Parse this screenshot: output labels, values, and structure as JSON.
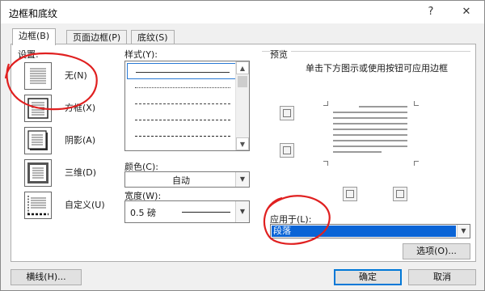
{
  "window": {
    "title": "边框和底纹",
    "help_label": "?",
    "close_label": "✕"
  },
  "tabs": [
    {
      "label": "边框(B)",
      "active": true
    },
    {
      "label": "页面边框(P)",
      "active": false
    },
    {
      "label": "底纹(S)",
      "active": false
    }
  ],
  "settings": {
    "label": "设置:",
    "items": [
      {
        "label": "无(N)",
        "icon": "border-none-icon"
      },
      {
        "label": "方框(X)",
        "icon": "border-box-icon"
      },
      {
        "label": "阴影(A)",
        "icon": "border-shadow-icon"
      },
      {
        "label": "三维(D)",
        "icon": "border-3d-icon"
      },
      {
        "label": "自定义(U)",
        "icon": "border-custom-icon"
      }
    ]
  },
  "style": {
    "label": "样式(Y):",
    "options": [
      "solid",
      "dotted-fine",
      "dotted",
      "dash-dot",
      "dashed",
      "dashed-long"
    ]
  },
  "color": {
    "label": "颜色(C):",
    "value": "自动"
  },
  "width": {
    "label": "宽度(W):",
    "value": "0.5 磅"
  },
  "preview": {
    "label": "预览",
    "hint": "单击下方图示或使用按钮可应用边框"
  },
  "apply_to": {
    "label": "应用于(L):",
    "value": "段落"
  },
  "buttons": {
    "options": "选项(O)...",
    "horizontal_line": "横线(H)...",
    "ok": "确定",
    "cancel": "取消"
  },
  "colors": {
    "annotation_red": "#e02020",
    "selection_blue": "#0a64d6",
    "accent": "#0078d7"
  }
}
